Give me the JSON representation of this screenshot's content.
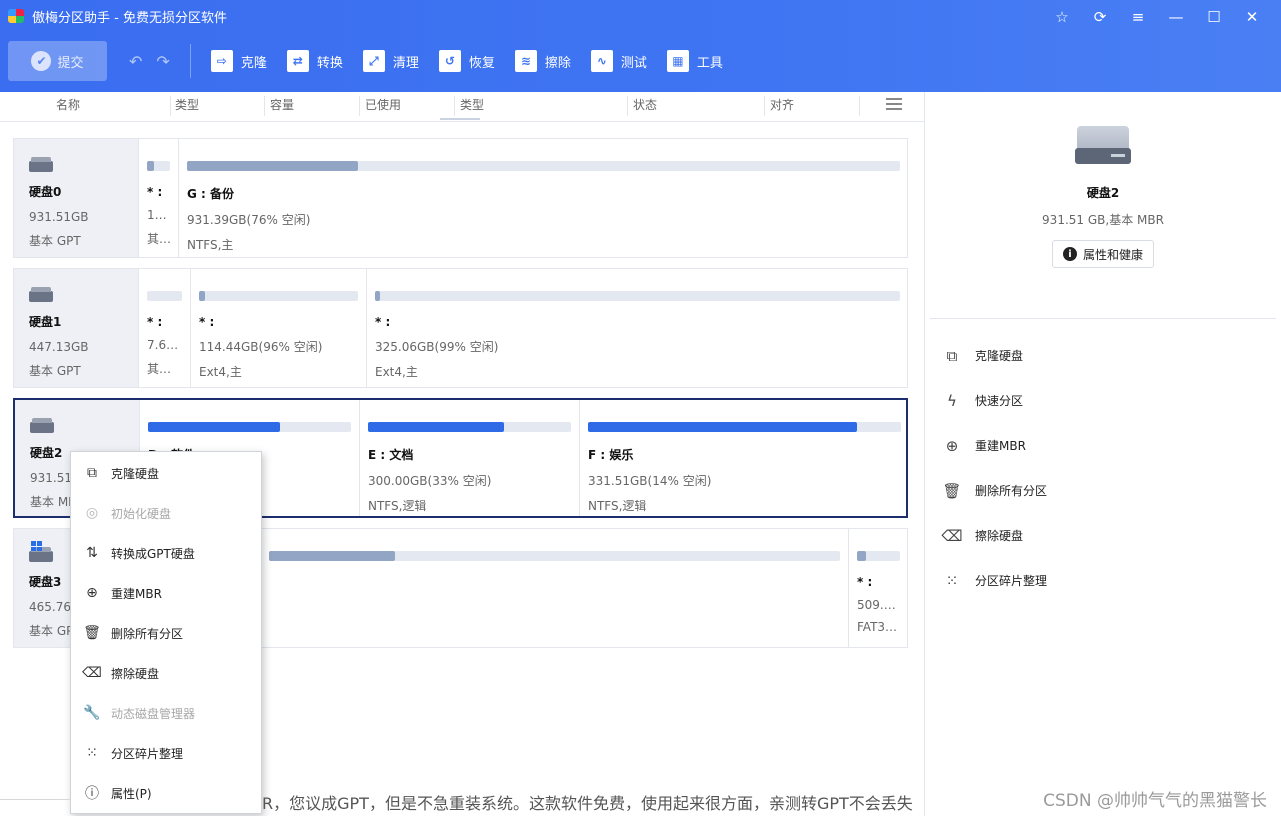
{
  "app": {
    "title": "傲梅分区助手 - 免费无损分区软件"
  },
  "toolbar": {
    "submit_label": "提交",
    "undo_glyph": "↶",
    "redo_glyph": "↷",
    "items": [
      {
        "label": "克隆",
        "icon": "clone-icon",
        "glyph": "⇨"
      },
      {
        "label": "转换",
        "icon": "convert-icon",
        "glyph": "⇄"
      },
      {
        "label": "清理",
        "icon": "clean-icon",
        "glyph": "⤢"
      },
      {
        "label": "恢复",
        "icon": "recover-icon",
        "glyph": "↺"
      },
      {
        "label": "擦除",
        "icon": "erase-icon",
        "glyph": "≋"
      },
      {
        "label": "测试",
        "icon": "test-icon",
        "glyph": "∿"
      },
      {
        "label": "工具",
        "icon": "tools-icon",
        "glyph": "▦"
      }
    ]
  },
  "window_controls": {
    "star": "☆",
    "refresh": "⟳",
    "menu": "≡",
    "minimize": "—",
    "maximize": "☐",
    "close": "✕"
  },
  "columns": [
    "名称",
    "类型",
    "容量",
    "已使用",
    "类型",
    "状态",
    "对齐"
  ],
  "disks": [
    {
      "name": "硬盘0",
      "size": "931.51GB",
      "type": "基本 GPT",
      "partitions": [
        {
          "letter": "* :",
          "free": "128...",
          "fs": "其...",
          "used": 0.3,
          "width": 40
        },
        {
          "letter": "G : 备份",
          "free": "931.39GB(76% 空闲)",
          "fs": "NTFS,主",
          "used": 0.24,
          "width": 730
        }
      ]
    },
    {
      "name": "硬盘1",
      "size": "447.13GB",
      "type": "基本 GPT",
      "partitions": [
        {
          "letter": "* :",
          "free": "7.63G...",
          "fs": "其他,主",
          "used": 0.0,
          "width": 52
        },
        {
          "letter": "* :",
          "free": "114.44GB(96% 空闲)",
          "fs": "Ext4,主",
          "used": 0.04,
          "width": 176
        },
        {
          "letter": "* :",
          "free": "325.06GB(99% 空闲)",
          "fs": "Ext4,主",
          "used": 0.01,
          "width": 542
        }
      ]
    },
    {
      "name": "硬盘2",
      "size": "931.51GB",
      "type": "基本 MBR",
      "partitions": [
        {
          "letter": "D : 软件",
          "free": "",
          "fs": "",
          "used": 0.65,
          "width": 220
        },
        {
          "letter": "E : 文档",
          "free": "300.00GB(33% 空闲)",
          "fs": "NTFS,逻辑",
          "used": 0.67,
          "width": 220
        },
        {
          "letter": "F : 娱乐",
          "free": "331.51GB(14% 空闲)",
          "fs": "NTFS,逻辑",
          "used": 0.86,
          "width": 330
        }
      ]
    },
    {
      "name": "硬盘3",
      "size": "465.76GB",
      "type": "基本 GPT",
      "partitions": [
        {
          "letter": "",
          "free": "",
          "fs": "",
          "used": 0.0,
          "width": 122
        },
        {
          "letter": "",
          "free": "",
          "fs": "",
          "used": 0.22,
          "width": 588
        },
        {
          "letter": "* :",
          "free": "509.88...",
          "fs": "FAT32,...",
          "used": 0.2,
          "width": 60
        }
      ]
    }
  ],
  "selected_disk": {
    "name": "硬盘2",
    "desc": "931.51 GB,基本 MBR",
    "properties_label": "属性和健康"
  },
  "right_actions": [
    {
      "label": "克隆硬盘",
      "icon": "clone-disk-icon",
      "glyph": "⧉"
    },
    {
      "label": "快速分区",
      "icon": "lightning-icon",
      "glyph": "ϟ"
    },
    {
      "label": "重建MBR",
      "icon": "rebuild-mbr-icon",
      "glyph": "⊕"
    },
    {
      "label": "删除所有分区",
      "icon": "trash-icon",
      "glyph": "🗑"
    },
    {
      "label": "擦除硬盘",
      "icon": "eraser-icon",
      "glyph": "⌫"
    },
    {
      "label": "分区碎片整理",
      "icon": "defrag-icon",
      "glyph": "⁙"
    }
  ],
  "context_menu": [
    {
      "label": "克隆硬盘",
      "icon": "clone-disk-icon",
      "glyph": "⧉",
      "disabled": false
    },
    {
      "label": "初始化硬盘",
      "icon": "init-disk-icon",
      "glyph": "◎",
      "disabled": true
    },
    {
      "label": "转换成GPT硬盘",
      "icon": "convert-gpt-icon",
      "glyph": "⇅",
      "disabled": false
    },
    {
      "label": "重建MBR",
      "icon": "rebuild-mbr-icon",
      "glyph": "⊕",
      "disabled": false
    },
    {
      "label": "删除所有分区",
      "icon": "trash-icon",
      "glyph": "🗑",
      "disabled": false
    },
    {
      "label": "擦除硬盘",
      "icon": "eraser-icon",
      "glyph": "⌫",
      "disabled": false
    },
    {
      "label": "动态磁盘管理器",
      "icon": "wrench-icon",
      "glyph": "🔧",
      "disabled": true
    },
    {
      "label": "分区碎片整理",
      "icon": "defrag-icon",
      "glyph": "⁙",
      "disabled": false
    },
    {
      "label": "属性(P)",
      "icon": "info-icon",
      "glyph": "ⓘ",
      "disabled": false
    }
  ],
  "below_text": "R，您议成GPT，但是不急重装系统。这款软件免费，使用起来很方面，亲测转GPT不会丢失",
  "watermark": "CSDN @帅帅气气的黑猫警长"
}
